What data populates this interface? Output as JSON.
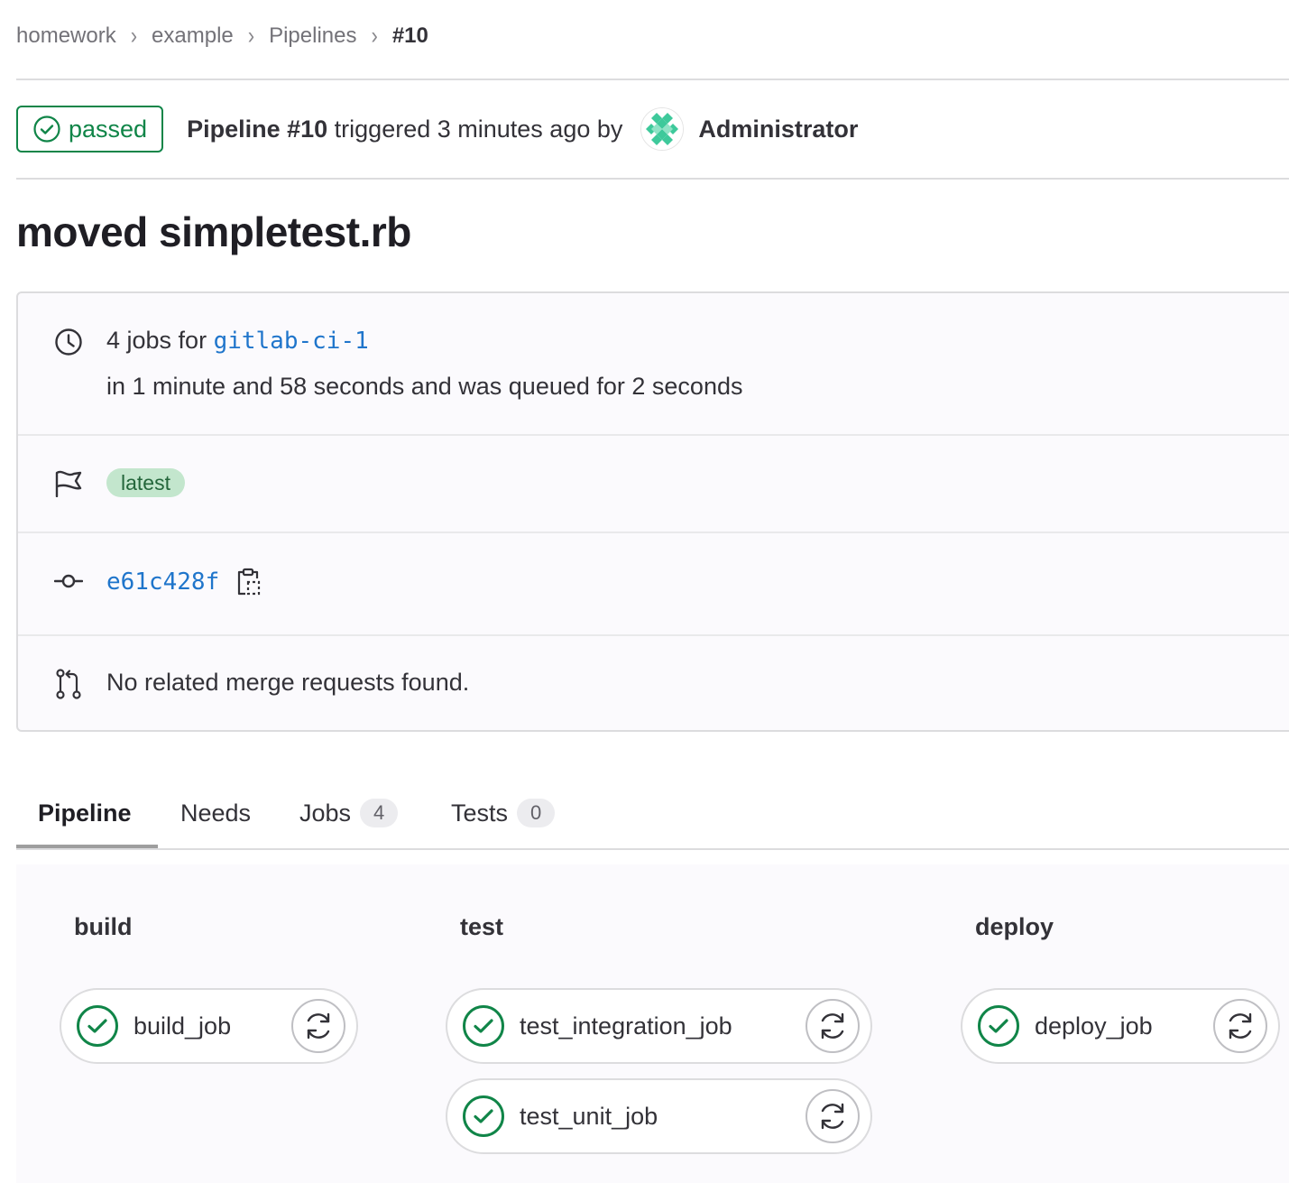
{
  "breadcrumb": {
    "items": [
      "homework",
      "example",
      "Pipelines"
    ],
    "current": "#10",
    "separator": "›"
  },
  "header": {
    "status": "passed",
    "pipeline_label": "Pipeline #10",
    "triggered_text": " triggered 3 minutes ago by",
    "author": "Administrator"
  },
  "title": "moved simpletest.rb",
  "info": {
    "jobs_prefix": "4 jobs for ",
    "ref": "gitlab-ci-1",
    "duration": "in 1 minute and 58 seconds and was queued for 2 seconds",
    "label": "latest",
    "commit_sha": "e61c428f",
    "merge_requests": "No related merge requests found."
  },
  "tabs": {
    "pipeline": "Pipeline",
    "needs": "Needs",
    "jobs": "Jobs",
    "jobs_count": "4",
    "tests": "Tests",
    "tests_count": "0"
  },
  "stages": {
    "build": {
      "name": "build",
      "jobs": [
        "build_job"
      ]
    },
    "test": {
      "name": "test",
      "jobs": [
        "test_integration_job",
        "test_unit_job"
      ]
    },
    "deploy": {
      "name": "deploy",
      "jobs": [
        "deploy_job"
      ]
    }
  },
  "colors": {
    "success": "#108548",
    "link": "#1f75cb",
    "label_bg": "#c3e6cd"
  }
}
